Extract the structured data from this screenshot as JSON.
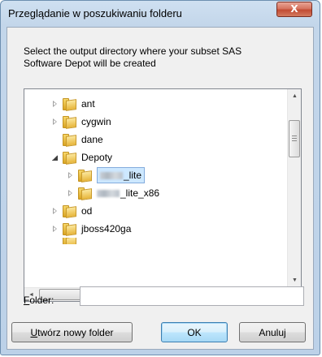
{
  "dialog": {
    "title": "Przeglądanie w poszukiwaniu folderu",
    "close_glyph": "X",
    "description_lines": [
      "Select the output directory where your subset SAS",
      "Software Depot will be created"
    ]
  },
  "tree": {
    "items": [
      {
        "label": "ant",
        "expander": "collapsed",
        "level": 0,
        "selected": false,
        "redacted_prefix": false
      },
      {
        "label": "cygwin",
        "expander": "collapsed",
        "level": 0,
        "selected": false,
        "redacted_prefix": false
      },
      {
        "label": "dane",
        "expander": "none",
        "level": 0,
        "selected": false,
        "redacted_prefix": false
      },
      {
        "label": "Depoty",
        "expander": "expanded",
        "level": 0,
        "selected": false,
        "redacted_prefix": false
      },
      {
        "label": "_lite",
        "expander": "collapsed",
        "level": 1,
        "selected": true,
        "redacted_prefix": true
      },
      {
        "label": "_lite_x86",
        "expander": "collapsed",
        "level": 1,
        "selected": false,
        "redacted_prefix": true
      },
      {
        "label": "od",
        "expander": "collapsed",
        "level": 0,
        "selected": false,
        "redacted_prefix": false
      },
      {
        "label": "jboss420ga",
        "expander": "collapsed",
        "level": 0,
        "selected": false,
        "redacted_prefix": false
      }
    ],
    "scroll_up_glyph": "▲",
    "scroll_down_glyph": "▼",
    "scroll_left_glyph": "◄",
    "scroll_right_glyph": "►"
  },
  "folder_field": {
    "label_accel": "F",
    "label_rest": "older:",
    "value": "",
    "placeholder": ""
  },
  "buttons": {
    "new_folder_accel": "U",
    "new_folder_rest": "twórz nowy folder",
    "ok": "OK",
    "cancel": "Anuluj"
  },
  "colors": {
    "selection_fill": "#cde8ff",
    "selection_border": "#84acdd",
    "close_button": "#c24b33",
    "default_button_border": "#3c7fb1"
  }
}
